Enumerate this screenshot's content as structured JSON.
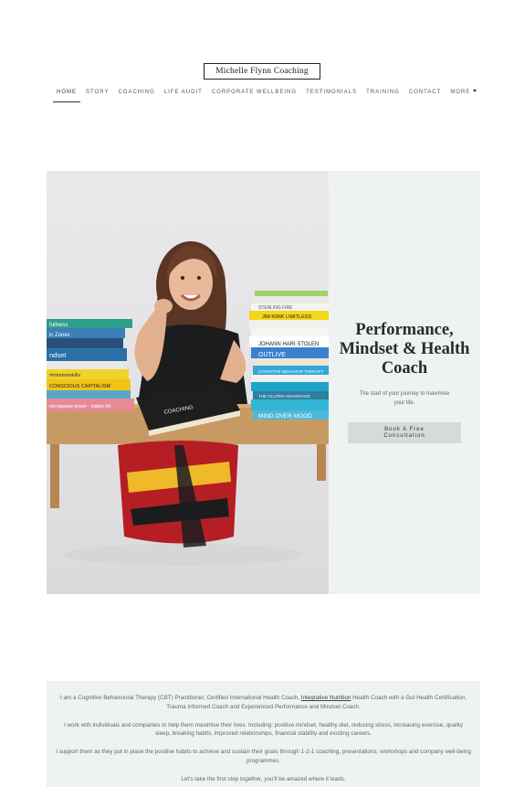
{
  "site": {
    "logo": "Michelle Flynn Coaching"
  },
  "nav": {
    "items": [
      "HOME",
      "STORY",
      "COACHING",
      "LIFE AUDIT",
      "CORPORATE WELLBEING",
      "TESTIMONIALS",
      "TRAINING",
      "CONTACT"
    ],
    "more": "MORE"
  },
  "hero": {
    "title_line1": "Performance,",
    "title_line2": "Mindset & Health",
    "title_line3": "Coach",
    "subtitle": "The start of your journey to maximise your life.",
    "cta_line1": "Book A Free",
    "cta_line2": "Consultation"
  },
  "photo": {
    "book_spines_left": [
      "fullness",
      "ic Zones",
      "ndset",
      "#mindsetskills",
      "CONSCIOUS CAPITALISM",
      "menopause power · maisie hill"
    ],
    "book_spines_right": [
      "STEALING FIRE",
      "JIM KWIK  LIMITLESS",
      "JOHANN HARI  STOLEN",
      "OUTLIVE",
      "COGNITIVE BEHAVIOR THERAPY",
      "THE GLUTEN ADVANTAGE",
      "MIND OVER MOOD"
    ],
    "book_on_table": "COACHING"
  },
  "about": {
    "p1_a": "I am a Cognitive Behavioural Therapy (CBT) Practitioner, Certified International Health Coach,",
    "p1_link": "Integrative Nutrition",
    "p1_b": "Health Coach with a Gut Health Certification, Trauma Informed Coach and Experienced Performance and Mindset Coach.",
    "p2": "I work with individuals and companies to help them maximise their lives.  Including: positive mindset, healthy diet, reducing stress, increasing exercise, quality sleep, breaking habits, improved relationships, financial stability and exciting careers.",
    "p3": "I support them as they put in place the positive habits to achieve and sustain their goals through 1-2-1 coaching, presentations, workshops and company well-being programmes.",
    "p4": "Let's take the first step together, you'll be amazed where it leads."
  },
  "colors": {
    "panel": "#eff2f2",
    "cta": "#d6dadb",
    "text": "#333333"
  }
}
